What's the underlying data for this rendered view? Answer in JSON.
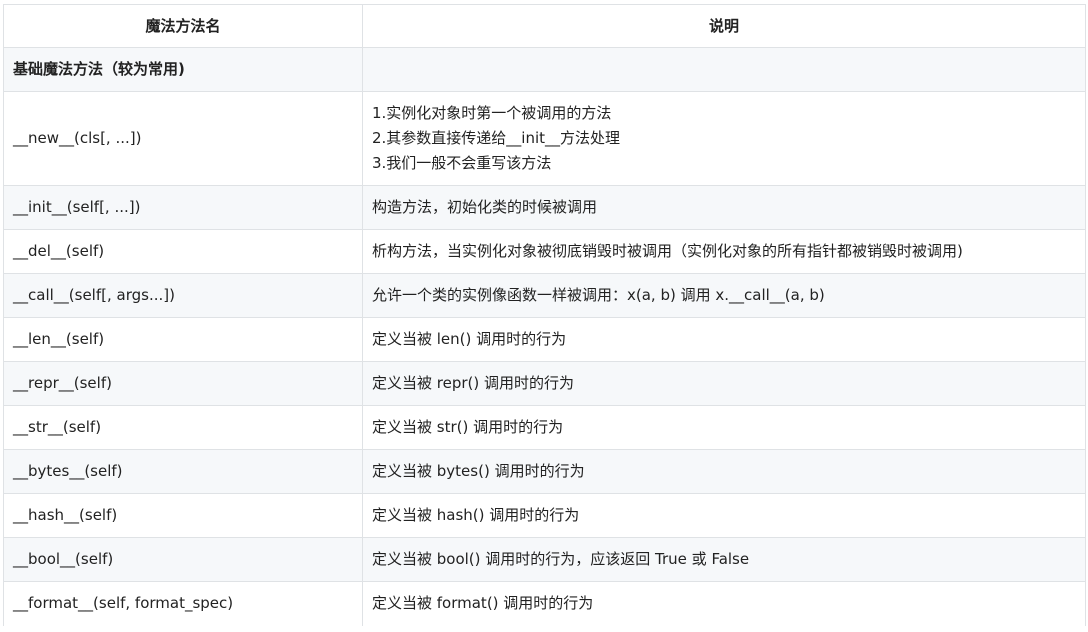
{
  "table": {
    "headers": [
      "魔法方法名",
      "说明"
    ],
    "section_title": "基础魔法方法（较为常用)",
    "rows": [
      {
        "method": "__new__(cls[, ...])",
        "desc": [
          "1.实例化对象时第一个被调用的方法",
          "2.其参数直接传递给__init__方法处理",
          "3.我们一般不会重写该方法"
        ]
      },
      {
        "method": "__init__(self[, ...])",
        "desc": [
          "构造方法，初始化类的时候被调用"
        ]
      },
      {
        "method": "__del__(self)",
        "desc": [
          "析构方法，当实例化对象被彻底销毁时被调用（实例化对象的所有指针都被销毁时被调用)"
        ]
      },
      {
        "method": "__call__(self[, args...])",
        "desc": [
          "允许一个类的实例像函数一样被调用：x(a, b) 调用 x.__call__(a, b)"
        ]
      },
      {
        "method": "__len__(self)",
        "desc": [
          "定义当被 len() 调用时的行为"
        ]
      },
      {
        "method": "__repr__(self)",
        "desc": [
          "定义当被 repr() 调用时的行为"
        ]
      },
      {
        "method": "__str__(self)",
        "desc": [
          "定义当被 str() 调用时的行为"
        ]
      },
      {
        "method": "__bytes__(self)",
        "desc": [
          "定义当被 bytes() 调用时的行为"
        ]
      },
      {
        "method": "__hash__(self)",
        "desc": [
          "定义当被 hash() 调用时的行为"
        ]
      },
      {
        "method": "__bool__(self)",
        "desc": [
          "定义当被 bool() 调用时的行为，应该返回 True 或 False"
        ]
      },
      {
        "method": "__format__(self, format_spec)",
        "desc": [
          "定义当被 format() 调用时的行为"
        ]
      }
    ]
  }
}
